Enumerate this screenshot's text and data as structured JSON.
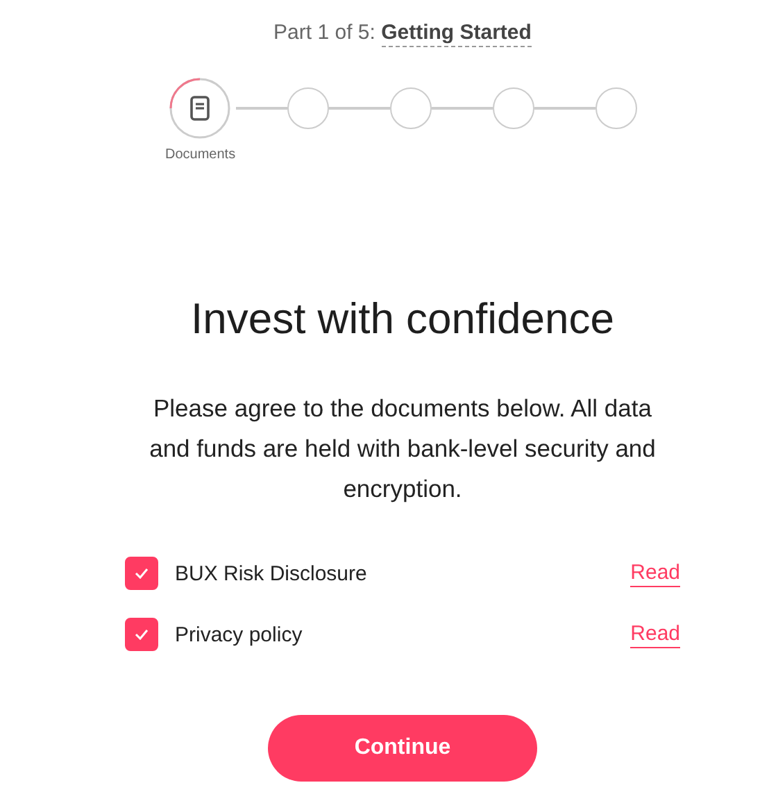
{
  "header": {
    "prefix": "Part 1 of 5:",
    "section": "Getting Started"
  },
  "steps": [
    {
      "label": "Documents",
      "selected": true
    },
    {
      "selected": false
    },
    {
      "selected": false
    },
    {
      "selected": false
    },
    {
      "selected": false
    }
  ],
  "title": "Invest with confidence",
  "description": "Please agree to the documents below. All data and funds are held with bank-level security and encryption.",
  "documents": [
    {
      "label": "BUX Risk Disclosure",
      "checked": true,
      "link": "Read"
    },
    {
      "label": "Privacy policy",
      "checked": true,
      "link": "Read"
    }
  ],
  "button": "Continue"
}
